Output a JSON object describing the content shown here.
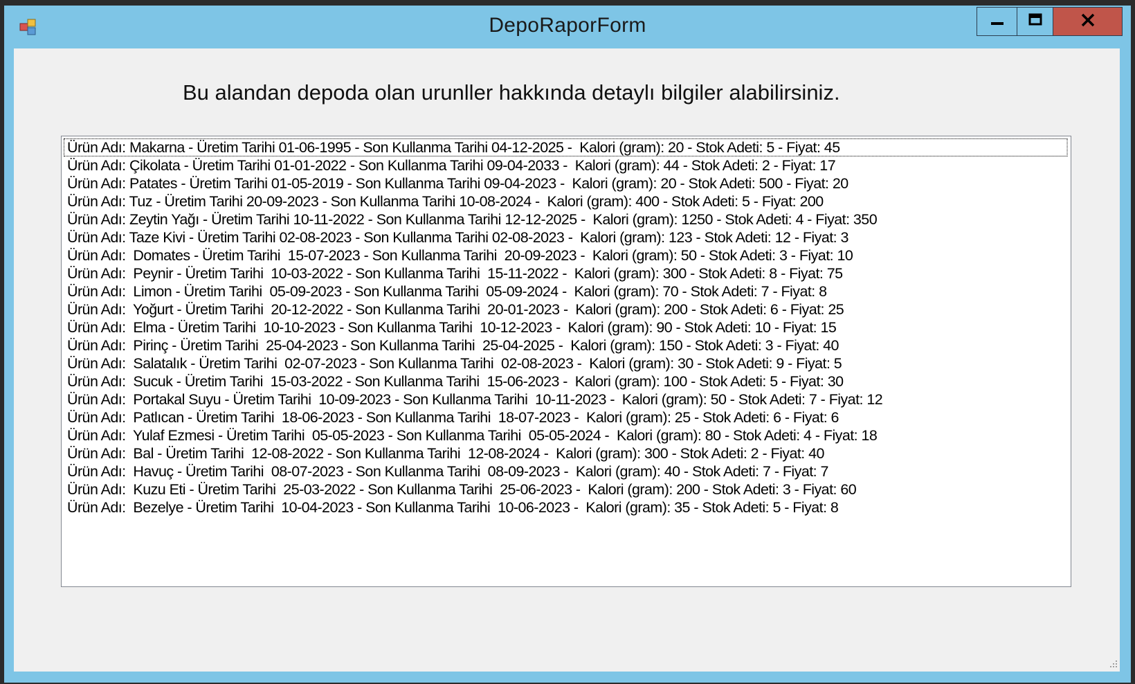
{
  "window": {
    "title": "DepoRaporForm",
    "title_color": "#7ec5e6",
    "close_color": "#c0554a"
  },
  "icons": {
    "app": "app-form-icon",
    "minimize": "minimize-icon",
    "maximize": "maximize-icon",
    "close": "close-icon",
    "grip": "resize-grip-icon"
  },
  "main": {
    "heading": "Bu alandan depoda olan urunller hakkında detaylı bilgiler alabilirsiniz."
  },
  "listbox": {
    "items": [
      "Ürün Adı: Makarna - Üretim Tarihi 01-06-1995 - Son Kullanma Tarihi 04-12-2025 -  Kalori (gram): 20 - Stok Adeti: 5 - Fiyat: 45",
      "Ürün Adı: Çikolata - Üretim Tarihi 01-01-2022 - Son Kullanma Tarihi 09-04-2033 -  Kalori (gram): 44 - Stok Adeti: 2 - Fiyat: 17",
      "Ürün Adı: Patates - Üretim Tarihi 01-05-2019 - Son Kullanma Tarihi 09-04-2023 -  Kalori (gram): 20 - Stok Adeti: 500 - Fiyat: 20",
      "Ürün Adı: Tuz - Üretim Tarihi 20-09-2023 - Son Kullanma Tarihi 10-08-2024 -  Kalori (gram): 400 - Stok Adeti: 5 - Fiyat: 200",
      "Ürün Adı: Zeytin Yağı - Üretim Tarihi 10-11-2022 - Son Kullanma Tarihi 12-12-2025 -  Kalori (gram): 1250 - Stok Adeti: 4 - Fiyat: 350",
      "Ürün Adı: Taze Kivi - Üretim Tarihi 02-08-2023 - Son Kullanma Tarihi 02-08-2023 -  Kalori (gram): 123 - Stok Adeti: 12 - Fiyat: 3",
      "Ürün Adı:  Domates - Üretim Tarihi  15-07-2023 - Son Kullanma Tarihi  20-09-2023 -  Kalori (gram): 50 - Stok Adeti: 3 - Fiyat: 10",
      "Ürün Adı:  Peynir - Üretim Tarihi  10-03-2022 - Son Kullanma Tarihi  15-11-2022 -  Kalori (gram): 300 - Stok Adeti: 8 - Fiyat: 75",
      "Ürün Adı:  Limon - Üretim Tarihi  05-09-2023 - Son Kullanma Tarihi  05-09-2024 -  Kalori (gram): 70 - Stok Adeti: 7 - Fiyat: 8",
      "Ürün Adı:  Yoğurt - Üretim Tarihi  20-12-2022 - Son Kullanma Tarihi  20-01-2023 -  Kalori (gram): 200 - Stok Adeti: 6 - Fiyat: 25",
      "Ürün Adı:  Elma - Üretim Tarihi  10-10-2023 - Son Kullanma Tarihi  10-12-2023 -  Kalori (gram): 90 - Stok Adeti: 10 - Fiyat: 15",
      "Ürün Adı:  Pirinç - Üretim Tarihi  25-04-2023 - Son Kullanma Tarihi  25-04-2025 -  Kalori (gram): 150 - Stok Adeti: 3 - Fiyat: 40",
      "Ürün Adı:  Salatalık - Üretim Tarihi  02-07-2023 - Son Kullanma Tarihi  02-08-2023 -  Kalori (gram): 30 - Stok Adeti: 9 - Fiyat: 5",
      "Ürün Adı:  Sucuk - Üretim Tarihi  15-03-2022 - Son Kullanma Tarihi  15-06-2023 -  Kalori (gram): 100 - Stok Adeti: 5 - Fiyat: 30",
      "Ürün Adı:  Portakal Suyu - Üretim Tarihi  10-09-2023 - Son Kullanma Tarihi  10-11-2023 -  Kalori (gram): 50 - Stok Adeti: 7 - Fiyat: 12",
      "Ürün Adı:  Patlıcan - Üretim Tarihi  18-06-2023 - Son Kullanma Tarihi  18-07-2023 -  Kalori (gram): 25 - Stok Adeti: 6 - Fiyat: 6",
      "Ürün Adı:  Yulaf Ezmesi - Üretim Tarihi  05-05-2023 - Son Kullanma Tarihi  05-05-2024 -  Kalori (gram): 80 - Stok Adeti: 4 - Fiyat: 18",
      "Ürün Adı:  Bal - Üretim Tarihi  12-08-2022 - Son Kullanma Tarihi  12-08-2024 -  Kalori (gram): 300 - Stok Adeti: 2 - Fiyat: 40",
      "Ürün Adı:  Havuç - Üretim Tarihi  08-07-2023 - Son Kullanma Tarihi  08-09-2023 -  Kalori (gram): 40 - Stok Adeti: 7 - Fiyat: 7",
      "Ürün Adı:  Kuzu Eti - Üretim Tarihi  25-03-2022 - Son Kullanma Tarihi  25-06-2023 -  Kalori (gram): 200 - Stok Adeti: 3 - Fiyat: 60",
      "Ürün Adı:  Bezelye - Üretim Tarihi  10-04-2023 - Son Kullanma Tarihi  10-06-2023 -  Kalori (gram): 35 - Stok Adeti: 5 - Fiyat: 8"
    ]
  }
}
